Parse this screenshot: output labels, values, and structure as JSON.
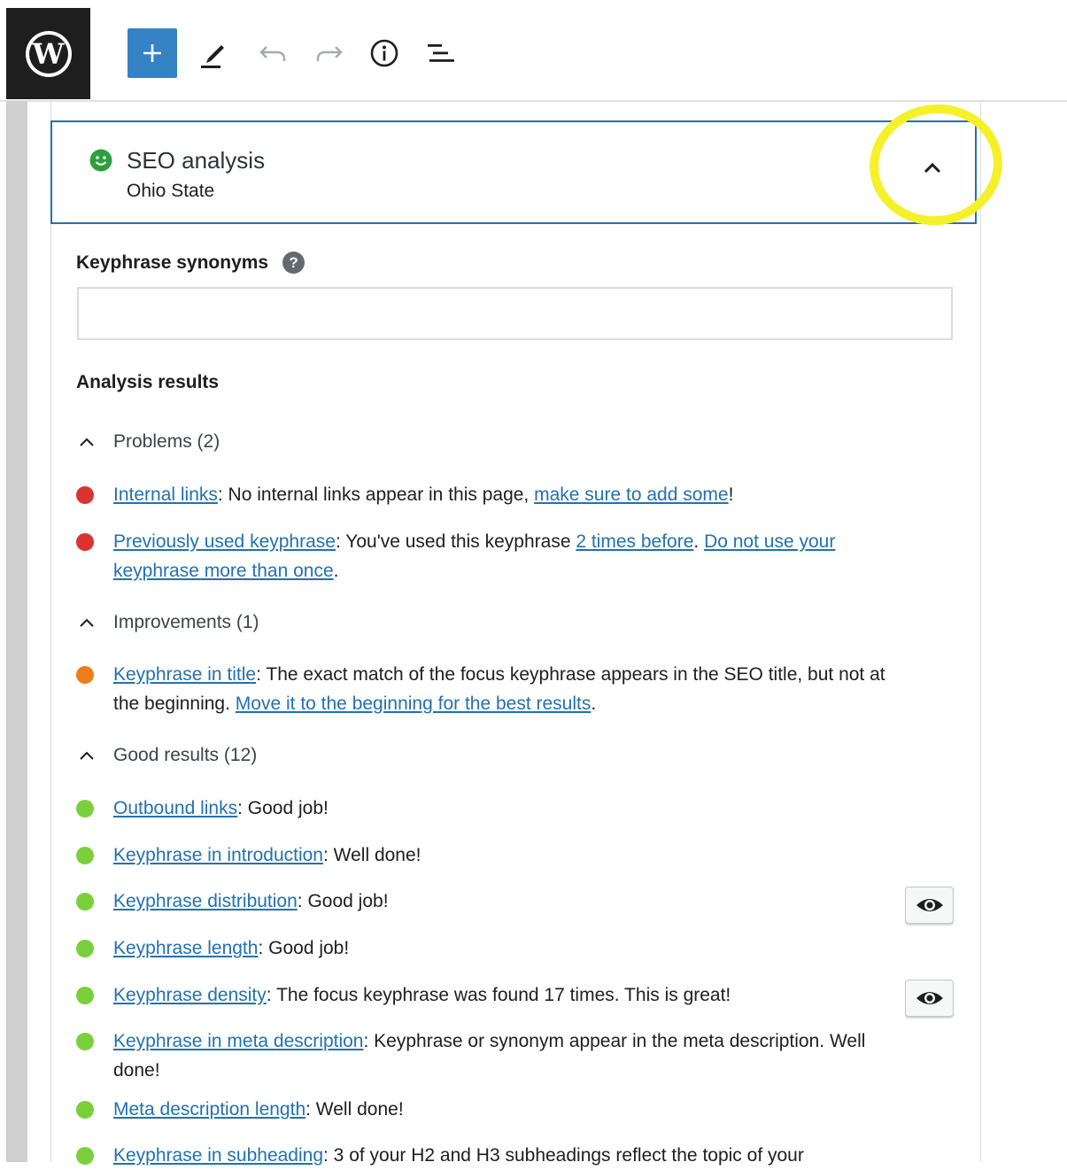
{
  "toolbar": {
    "logo_glyph": "W",
    "add_glyph": "+"
  },
  "seo_panel": {
    "title": "SEO analysis",
    "subtitle": "Ohio State",
    "status_color": "#2e9e3f"
  },
  "synonyms": {
    "label": "Keyphrase synonyms",
    "help_glyph": "?",
    "value": ""
  },
  "analysis": {
    "heading": "Analysis results",
    "problems": {
      "label": "Problems (2)",
      "items": [
        {
          "link": "Internal links",
          "text": ": No internal links appear in this page, ",
          "link2": "make sure to add some",
          "tail": "!"
        },
        {
          "link": "Previously used keyphrase",
          "text": ": You've used this keyphrase ",
          "link2": "2 times before",
          "mid": ". ",
          "link3": "Do not use your keyphrase more than once",
          "tail": "."
        }
      ]
    },
    "improvements": {
      "label": "Improvements (1)",
      "items": [
        {
          "link": "Keyphrase in title",
          "text": ": The exact match of the focus keyphrase appears in the SEO title, but not at the beginning. ",
          "link2": "Move it to the beginning for the best results",
          "tail": "."
        }
      ]
    },
    "good": {
      "label": "Good results (12)",
      "items": [
        {
          "link": "Outbound links",
          "text": ": Good job!"
        },
        {
          "link": "Keyphrase in introduction",
          "text": ": Well done!"
        },
        {
          "link": "Keyphrase distribution",
          "text": ": Good job!"
        },
        {
          "link": "Keyphrase length",
          "text": ": Good job!"
        },
        {
          "link": "Keyphrase density",
          "text": ": The focus keyphrase was found 17 times. This is great!"
        },
        {
          "link": "Keyphrase in meta description",
          "text": ": Keyphrase or synonym appear in the meta description. Well done!"
        },
        {
          "link": "Meta description length",
          "text": ": Well done!"
        },
        {
          "link": "Keyphrase in subheading",
          "text": ": 3 of your H2 and H3 subheadings reflect the topic of your"
        }
      ]
    }
  },
  "colors": {
    "problem": "#dc3232",
    "improvement": "#ee7c1b",
    "good": "#7ad03a",
    "link": "#2271b1",
    "highlight": "#f4f12a"
  }
}
